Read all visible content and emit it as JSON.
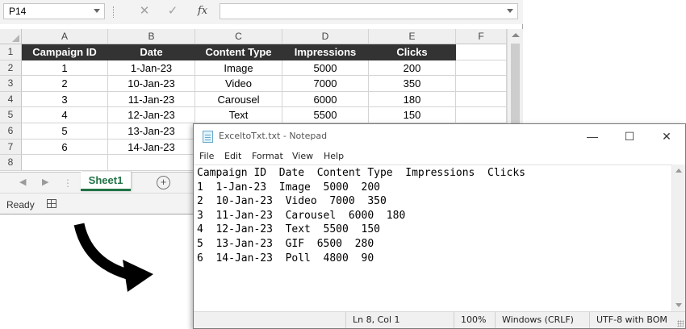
{
  "excel": {
    "name_box": "P14",
    "formula_icons": [
      "close-icon",
      "check-icon",
      "fx-icon"
    ],
    "fx_label": "fx",
    "columns": [
      "A",
      "B",
      "C",
      "D",
      "E",
      "F"
    ],
    "rows": [
      "1",
      "2",
      "3",
      "4",
      "5",
      "6",
      "7",
      "8"
    ],
    "headers": [
      "Campaign ID",
      "Date",
      "Content Type",
      "Impressions",
      "Clicks"
    ],
    "data": [
      [
        "1",
        "1-Jan-23",
        "Image",
        "5000",
        "200"
      ],
      [
        "2",
        "10-Jan-23",
        "Video",
        "7000",
        "350"
      ],
      [
        "3",
        "11-Jan-23",
        "Carousel",
        "6000",
        "180"
      ],
      [
        "4",
        "12-Jan-23",
        "Text",
        "5500",
        "150"
      ],
      [
        "5",
        "13-Jan-23",
        "",
        "",
        ""
      ],
      [
        "6",
        "14-Jan-23",
        "",
        "",
        ""
      ]
    ],
    "sheet_tab": "Sheet1",
    "add_sheet": "+",
    "status": "Ready",
    "header_fill": "#333333",
    "accent": "#217346"
  },
  "notepad": {
    "title": "ExceltoTxt.txt - Notepad",
    "menu": [
      "File",
      "Edit",
      "Format",
      "View",
      "Help"
    ],
    "window_buttons": [
      "—",
      "☐",
      "✕"
    ],
    "lines": [
      "Campaign ID  Date  Content Type  Impressions  Clicks",
      "1  1-Jan-23  Image  5000  200",
      "2  10-Jan-23  Video  7000  350",
      "3  11-Jan-23  Carousel  6000  180",
      "4  12-Jan-23  Text  5500  150",
      "5  13-Jan-23  GIF  6500  280",
      "6  14-Jan-23  Poll  4800  90"
    ],
    "status": {
      "position": "Ln 8, Col 1",
      "zoom": "100%",
      "line_ending": "Windows (CRLF)",
      "encoding": "UTF-8 with BOM"
    }
  },
  "arrow_icon": "curved-arrow-icon"
}
